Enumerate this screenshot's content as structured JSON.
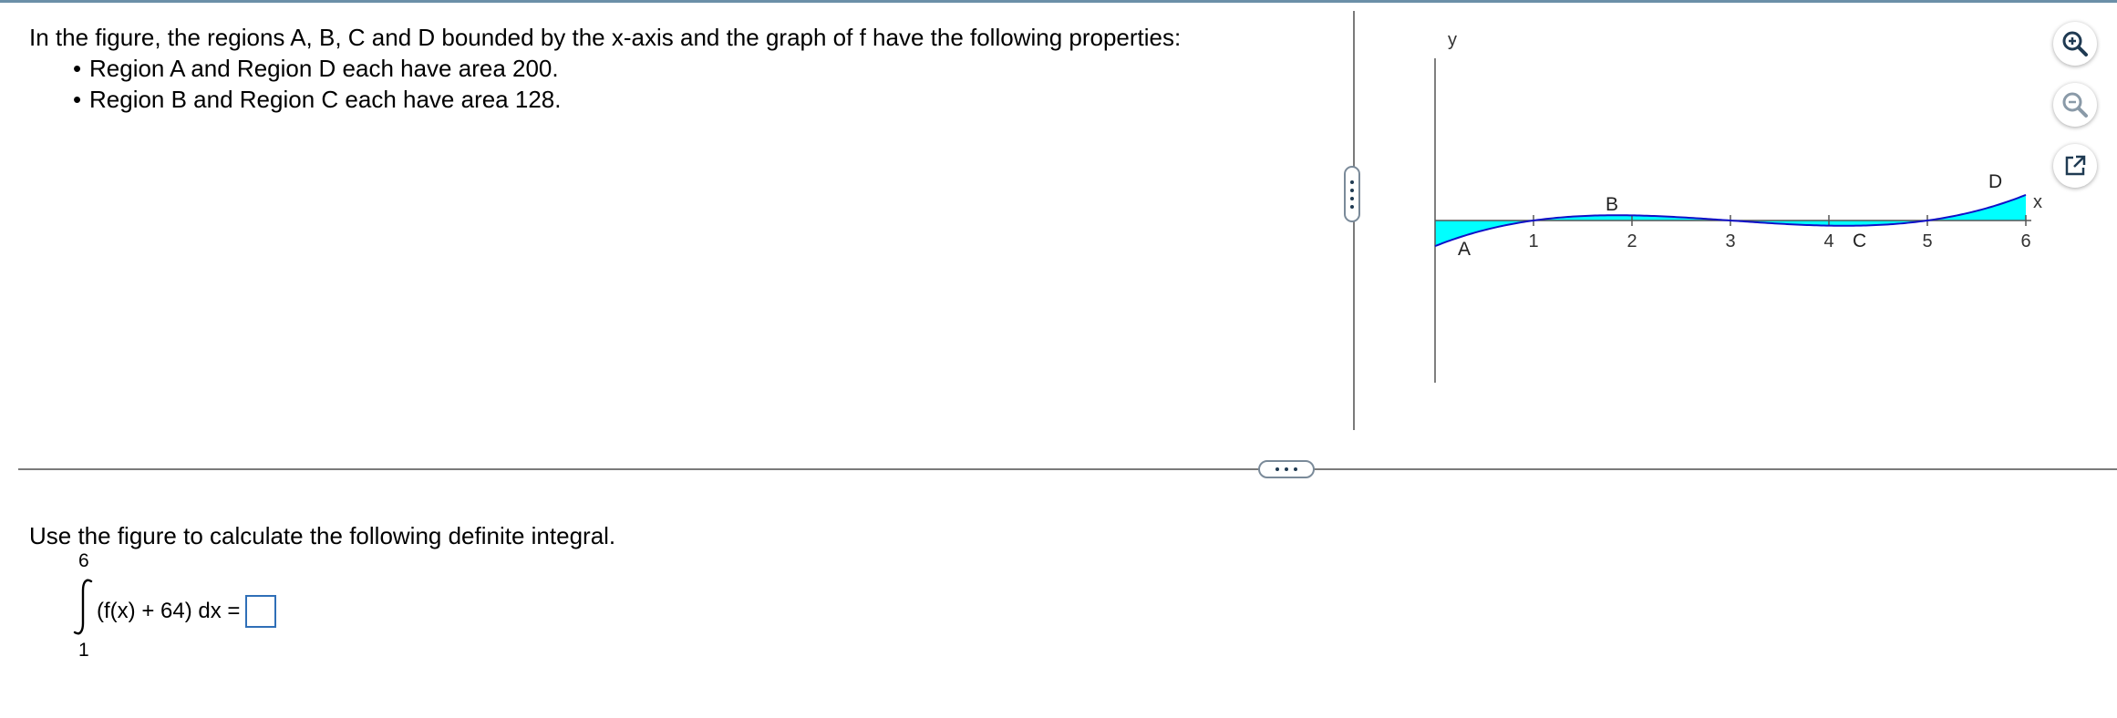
{
  "problem": {
    "intro": "In the figure, the regions A, B, C and D bounded by the x-axis and the graph of f have the following properties:",
    "bullets": [
      "Region A and Region D each have area 200.",
      "Region B and Region C each have area 128."
    ],
    "bullet_glyph": "•"
  },
  "figure": {
    "y_label": "y",
    "x_label": "x",
    "x_ticks": [
      "1",
      "2",
      "3",
      "4",
      "5",
      "6"
    ],
    "regions": [
      "A",
      "B",
      "C",
      "D"
    ],
    "fill_color": "#00ffff",
    "curve_color": "#1010c8",
    "roots": [
      1,
      3,
      5
    ]
  },
  "tools": {
    "zoom_in": "zoom-in",
    "zoom_out": "zoom-out",
    "popout": "popout"
  },
  "question": {
    "instruction": "Use the figure to calculate the following definite integral.",
    "upper_limit": "6",
    "lower_limit": "1",
    "integrand": "(f(x) + 64) dx =",
    "answer_value": ""
  }
}
